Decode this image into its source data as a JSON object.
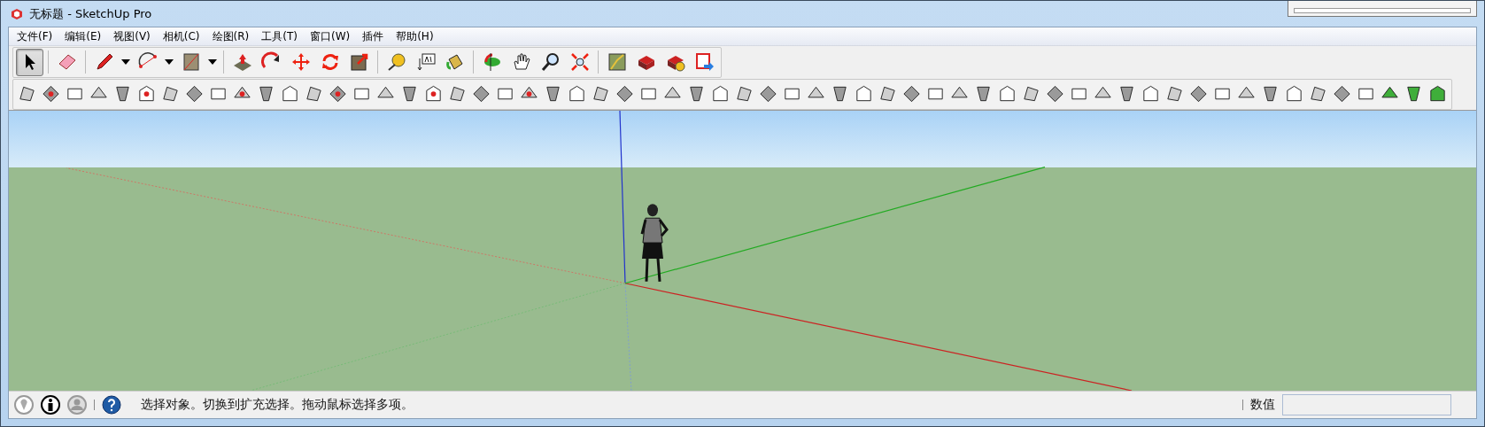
{
  "window": {
    "title": "无标题 - SketchUp Pro"
  },
  "menu": [
    {
      "label": "文件(F)"
    },
    {
      "label": "编辑(E)"
    },
    {
      "label": "视图(V)"
    },
    {
      "label": "相机(C)"
    },
    {
      "label": "绘图(R)"
    },
    {
      "label": "工具(T)"
    },
    {
      "label": "窗口(W)"
    },
    {
      "label": "插件"
    },
    {
      "label": "帮助(H)"
    }
  ],
  "main_toolbar": {
    "tools": [
      {
        "kind": "select",
        "selected": true
      },
      {
        "kind": "sep"
      },
      {
        "kind": "eraser",
        "selected": false
      },
      {
        "kind": "sep"
      },
      {
        "kind": "pencil",
        "selected": false
      },
      {
        "kind": "caret"
      },
      {
        "kind": "arc",
        "selected": false
      },
      {
        "kind": "caret"
      },
      {
        "kind": "rect",
        "selected": false
      },
      {
        "kind": "caret"
      },
      {
        "kind": "sep"
      },
      {
        "kind": "pushpull",
        "selected": false
      },
      {
        "kind": "followme",
        "selected": false
      },
      {
        "kind": "move",
        "selected": false
      },
      {
        "kind": "rotate",
        "selected": false
      },
      {
        "kind": "scale",
        "selected": false
      },
      {
        "kind": "sep"
      },
      {
        "kind": "tape",
        "selected": false
      },
      {
        "kind": "text",
        "selected": false
      },
      {
        "kind": "paint",
        "selected": false
      },
      {
        "kind": "sep"
      },
      {
        "kind": "orbit",
        "selected": false
      },
      {
        "kind": "pan",
        "selected": false
      },
      {
        "kind": "zoom",
        "selected": false
      },
      {
        "kind": "extents",
        "selected": false
      },
      {
        "kind": "sep"
      },
      {
        "kind": "map",
        "selected": false
      },
      {
        "kind": "warehouse",
        "selected": false
      },
      {
        "kind": "share",
        "selected": false
      },
      {
        "kind": "export",
        "selected": false
      }
    ]
  },
  "status_bar": {
    "message": "选择对象。切换到扩充选择。拖动鼠标选择多项。",
    "measurements_label": "数值"
  }
}
